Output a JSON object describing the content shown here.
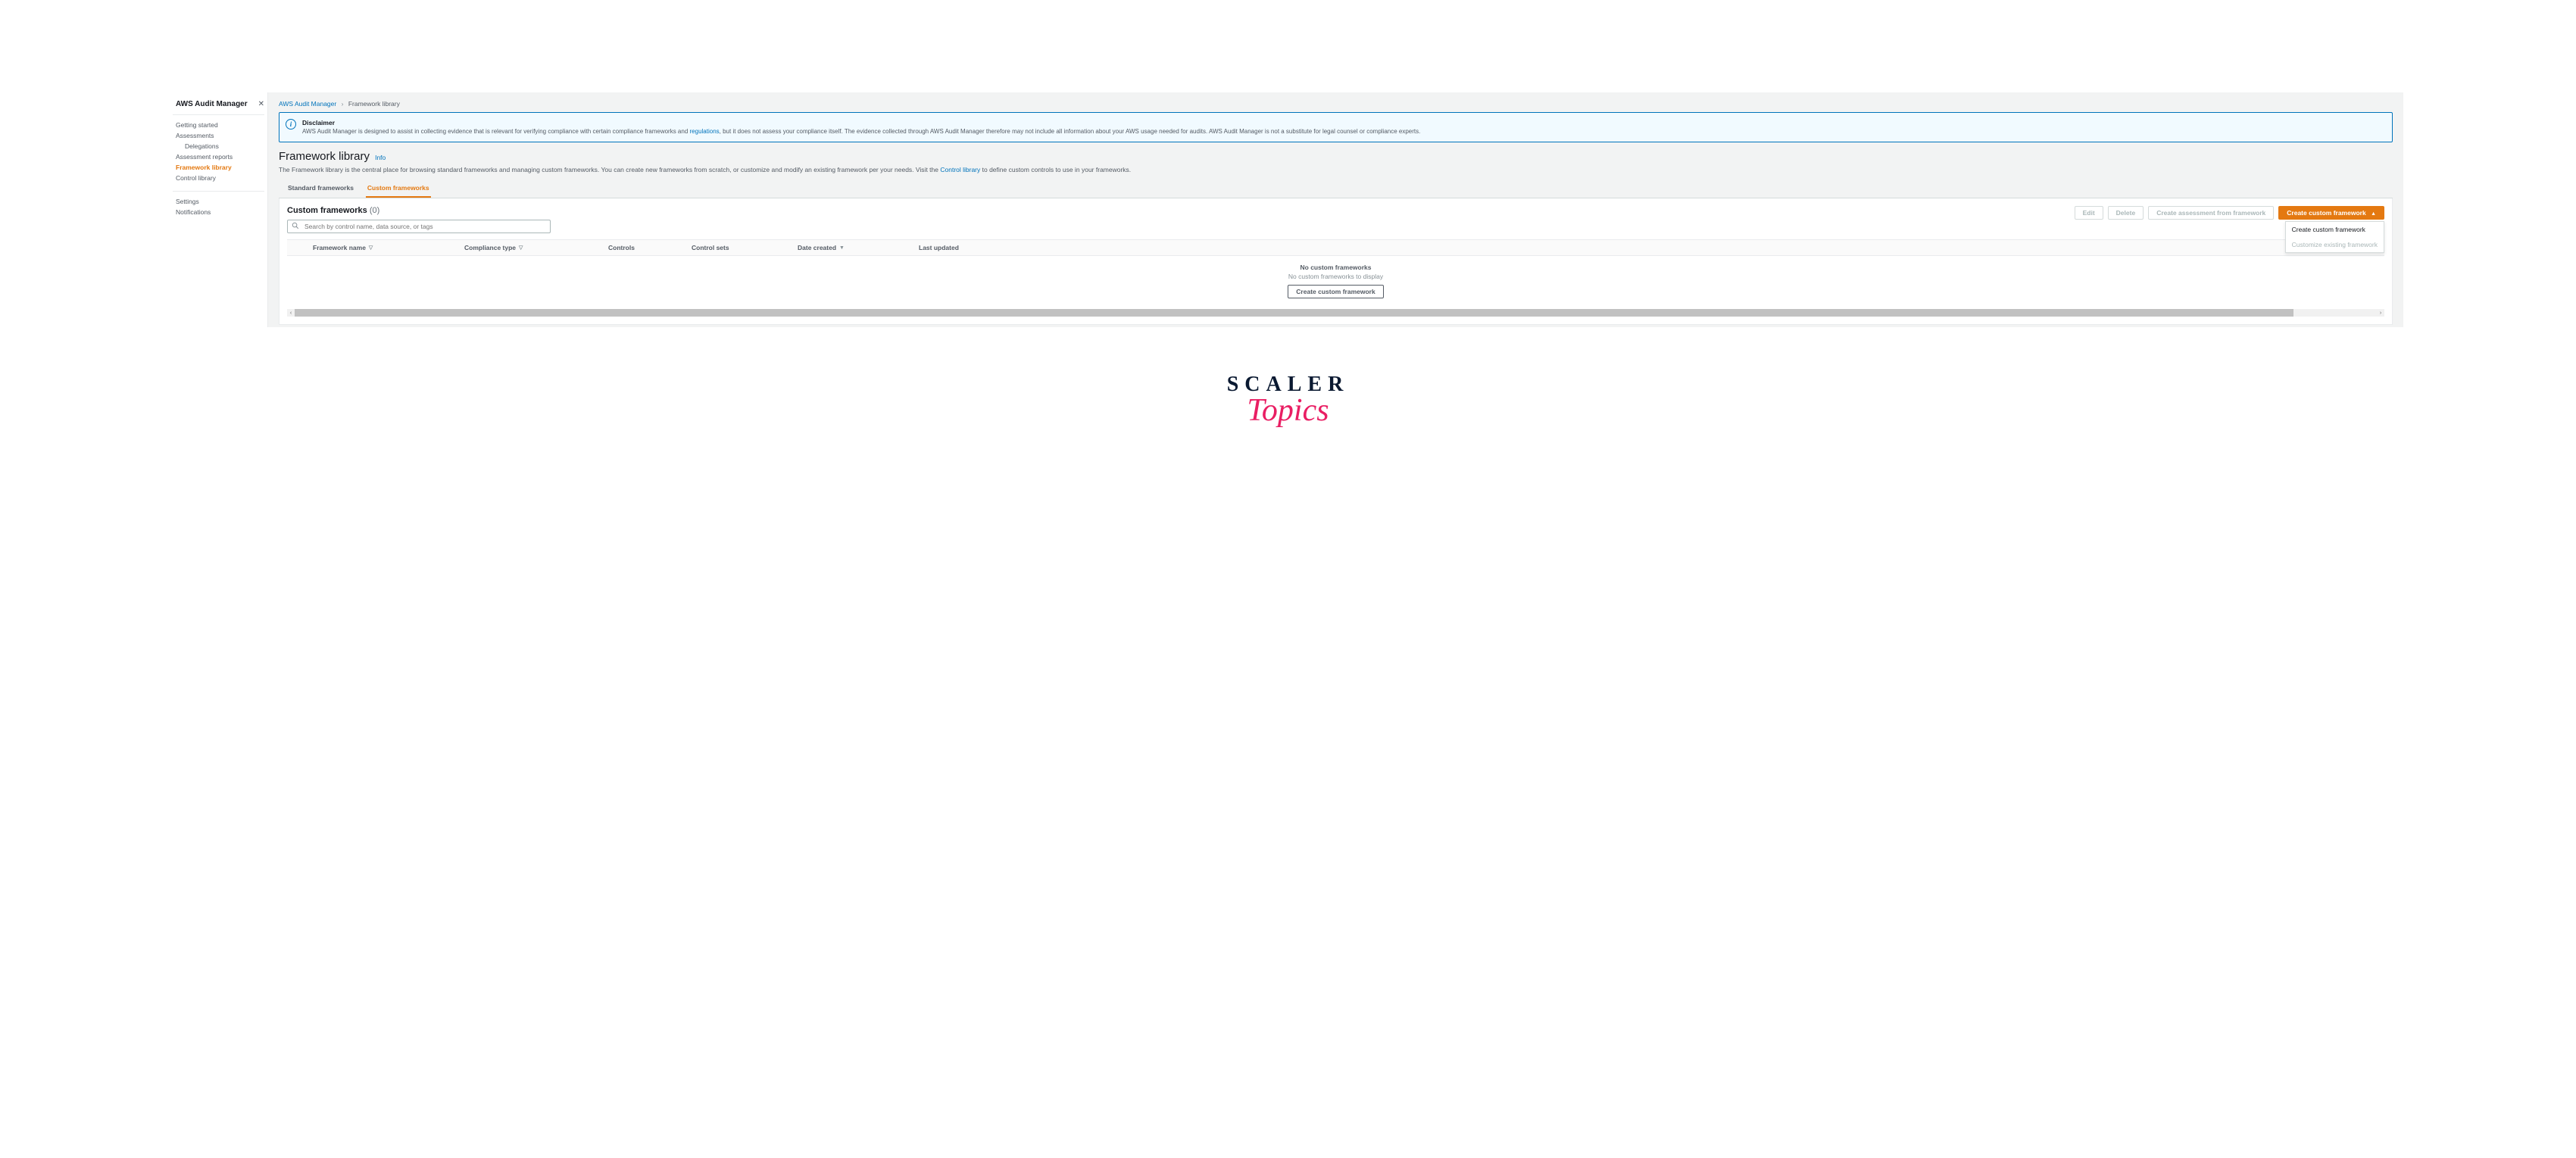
{
  "sidebar": {
    "title": "AWS Audit Manager",
    "nav": [
      {
        "label": "Getting started",
        "active": false,
        "sub": false
      },
      {
        "label": "Assessments",
        "active": false,
        "sub": false
      },
      {
        "label": "Delegations",
        "active": false,
        "sub": true
      },
      {
        "label": "Assessment reports",
        "active": false,
        "sub": false
      },
      {
        "label": "Framework library",
        "active": true,
        "sub": false
      },
      {
        "label": "Control library",
        "active": false,
        "sub": false
      }
    ],
    "nav2": [
      {
        "label": "Settings"
      },
      {
        "label": "Notifications"
      }
    ]
  },
  "breadcrumb": {
    "root": "AWS Audit Manager",
    "current": "Framework library"
  },
  "disclaimer": {
    "title": "Disclaimer",
    "body_pre": "AWS Audit Manager is designed to assist in collecting evidence that is relevant for verifying compliance with certain compliance frameworks and ",
    "link": "regulations",
    "body_post": ", but it does not assess your compliance itself. The evidence collected through AWS Audit Manager therefore may not include all information about your AWS usage needed for audits. AWS Audit Manager is not a substitute for legal counsel or compliance experts."
  },
  "header": {
    "title": "Framework library",
    "info": "Info",
    "desc_pre": "The Framework library is the central place for browsing standard frameworks and managing custom frameworks. You can create new frameworks from scratch, or customize and modify an existing framework per your needs. Visit the ",
    "desc_link": "Control library",
    "desc_post": " to define custom controls to use in your frameworks."
  },
  "tabs": {
    "standard": "Standard frameworks",
    "custom": "Custom frameworks"
  },
  "panel": {
    "title": "Custom frameworks",
    "count": "(0)",
    "search_placeholder": "Search by control name, data source, or tags",
    "actions": {
      "edit": "Edit",
      "delete": "Delete",
      "create_assessment": "Create assessment from framework",
      "create_custom": "Create custom framework"
    },
    "dropdown": {
      "create": "Create custom framework",
      "customize": "Customize existing framework"
    },
    "columns": {
      "name": "Framework name",
      "type": "Compliance type",
      "controls": "Controls",
      "sets": "Control sets",
      "date": "Date created",
      "updated": "Last updated"
    },
    "empty": {
      "heading": "No custom frameworks",
      "sub": "No custom frameworks to display",
      "button": "Create custom framework"
    }
  },
  "watermark": {
    "line1": "SCALER",
    "line2": "Topics"
  }
}
